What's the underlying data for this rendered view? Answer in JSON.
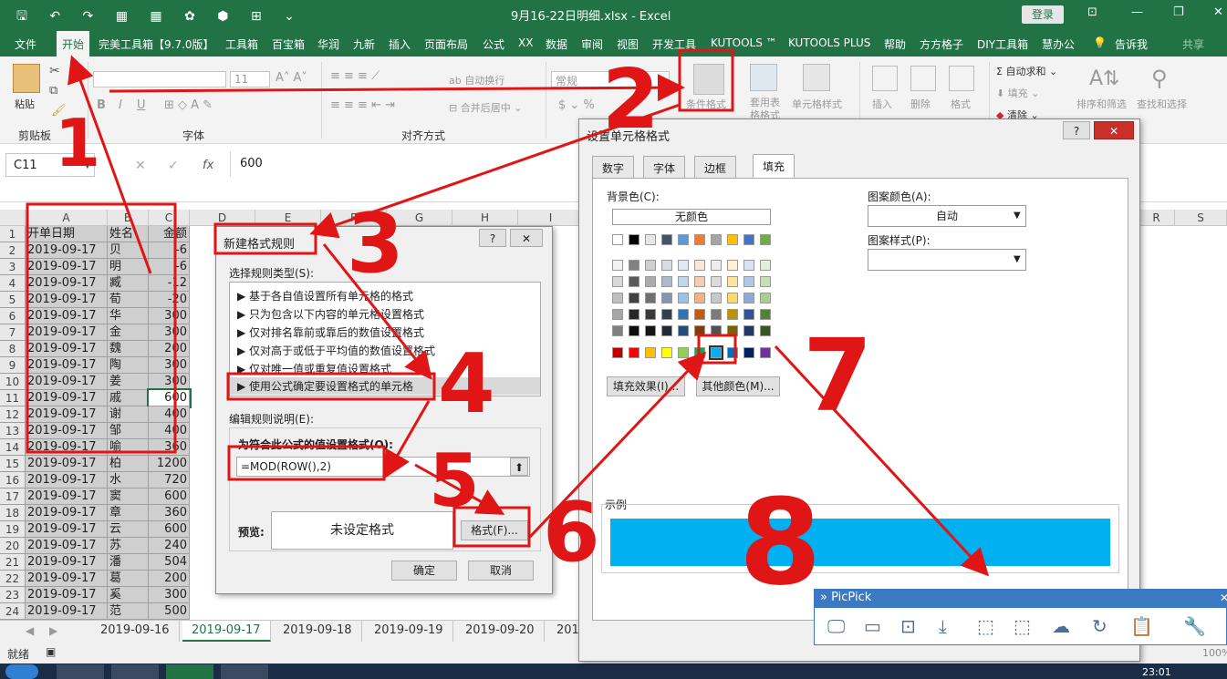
{
  "title_bar": {
    "title": "9月16-22日明细.xlsx - Excel",
    "login": "登录"
  },
  "menu": [
    "文件",
    "开始",
    "完美工具箱【9.7.0版】",
    "工具箱",
    "百宝箱",
    "华润",
    "九新",
    "插入",
    "页面布局",
    "公式",
    "XX",
    "数据",
    "审阅",
    "视图",
    "开发工具",
    "KUTOOLS ™",
    "KUTOOLS PLUS",
    "帮助",
    "方方格子",
    "DIY工具箱",
    "慧办公",
    "告诉我",
    "共享"
  ],
  "ribbon": {
    "paste": "粘贴",
    "clipboard": "剪贴板",
    "font_size": "11",
    "font_group": "字体",
    "wrap_text": "自动换行",
    "merge_center": "合并后居中",
    "align_group": "对齐方式",
    "number_format": "常规",
    "conditional_format": "条件格式",
    "table_format": "套用表格格式",
    "cell_style": "单元格样式",
    "insert": "插入",
    "delete": "删除",
    "format": "格式",
    "autosum": "自动求和",
    "fill": "填充",
    "clear": "清除",
    "sort_filter": "排序和筛选",
    "find_select": "查找和选择"
  },
  "formula_bar": {
    "name_box": "C11",
    "fx": "fx",
    "value": "600"
  },
  "columns": [
    "A",
    "B",
    "C",
    "D",
    "E",
    "F",
    "G",
    "H",
    "I"
  ],
  "far_columns": [
    "R",
    "S"
  ],
  "rows": [
    {
      "n": "1",
      "a": "开单日期",
      "b": "姓名",
      "c": "金额"
    },
    {
      "n": "2",
      "a": "2019-09-17",
      "b": "贝",
      "c": "-6"
    },
    {
      "n": "3",
      "a": "2019-09-17",
      "b": "明",
      "c": "-6"
    },
    {
      "n": "4",
      "a": "2019-09-17",
      "b": "臧",
      "c": "-12"
    },
    {
      "n": "5",
      "a": "2019-09-17",
      "b": "荀",
      "c": "-20"
    },
    {
      "n": "6",
      "a": "2019-09-17",
      "b": "华",
      "c": "300"
    },
    {
      "n": "7",
      "a": "2019-09-17",
      "b": "金",
      "c": "300"
    },
    {
      "n": "8",
      "a": "2019-09-17",
      "b": "魏",
      "c": "200"
    },
    {
      "n": "9",
      "a": "2019-09-17",
      "b": "陶",
      "c": "300"
    },
    {
      "n": "10",
      "a": "2019-09-17",
      "b": "姜",
      "c": "300"
    },
    {
      "n": "11",
      "a": "2019-09-17",
      "b": "戚",
      "c": "600"
    },
    {
      "n": "12",
      "a": "2019-09-17",
      "b": "谢",
      "c": "400"
    },
    {
      "n": "13",
      "a": "2019-09-17",
      "b": "邹",
      "c": "400"
    },
    {
      "n": "14",
      "a": "2019-09-17",
      "b": "喻",
      "c": "360"
    },
    {
      "n": "15",
      "a": "2019-09-17",
      "b": "柏",
      "c": "1200"
    },
    {
      "n": "16",
      "a": "2019-09-17",
      "b": "水",
      "c": "720"
    },
    {
      "n": "17",
      "a": "2019-09-17",
      "b": "窦",
      "c": "600"
    },
    {
      "n": "18",
      "a": "2019-09-17",
      "b": "章",
      "c": "360"
    },
    {
      "n": "19",
      "a": "2019-09-17",
      "b": "云",
      "c": "600"
    },
    {
      "n": "20",
      "a": "2019-09-17",
      "b": "苏",
      "c": "240"
    },
    {
      "n": "21",
      "a": "2019-09-17",
      "b": "潘",
      "c": "504"
    },
    {
      "n": "22",
      "a": "2019-09-17",
      "b": "葛",
      "c": "200"
    },
    {
      "n": "23",
      "a": "2019-09-17",
      "b": "奚",
      "c": "300"
    },
    {
      "n": "24",
      "a": "2019-09-17",
      "b": "范",
      "c": "500"
    }
  ],
  "sheet_tabs": [
    "2019-09-16",
    "2019-09-17",
    "2019-09-18",
    "2019-09-19",
    "2019-09-20",
    "201"
  ],
  "status": {
    "ready": "就绪",
    "zoom": "100%",
    "clock": "23:01"
  },
  "new_rule_dialog": {
    "title": "新建格式规则",
    "select_type": "选择规则类型(S):",
    "rules": [
      "基于各自值设置所有单元格的格式",
      "只为包含以下内容的单元格设置格式",
      "仅对排名靠前或靠后的数值设置格式",
      "仅对高于或低于平均值的数值设置格式",
      "仅对唯一值或重复值设置格式",
      "使用公式确定要设置格式的单元格"
    ],
    "edit_desc": "编辑规则说明(E):",
    "formula_label": "为符合此公式的值设置格式(O):",
    "formula": "=MOD(ROW(),2)",
    "preview_label": "预览:",
    "preview_text": "未设定格式",
    "format_btn": "格式(F)...",
    "ok": "确定",
    "cancel": "取消"
  },
  "format_cells_dialog": {
    "title": "设置单元格格式",
    "tabs": [
      "数字",
      "字体",
      "边框",
      "填充"
    ],
    "bg_color": "背景色(C):",
    "no_color": "无颜色",
    "pattern_color": "图案颜色(A):",
    "pattern_color_value": "自动",
    "pattern_style": "图案样式(P):",
    "fill_effects": "填充效果(I)...",
    "more_colors": "其他颜色(M)...",
    "sample": "示例",
    "sample_color": "#00b0f0",
    "theme_top": [
      "#ffffff",
      "#000000",
      "#e7e6e6",
      "#44546a",
      "#5b9bd5",
      "#ed7d31",
      "#a5a5a5",
      "#ffc000",
      "#4472c4",
      "#70ad47"
    ],
    "theme_shades": [
      [
        "#f2f2f2",
        "#808080",
        "#d0cece",
        "#d6dce4",
        "#deebf6",
        "#fbe5d5",
        "#ededed",
        "#fff2cc",
        "#d9e2f3",
        "#e2efd9"
      ],
      [
        "#d9d9d9",
        "#595959",
        "#aeabab",
        "#adb9ca",
        "#bdd7ee",
        "#f7cbac",
        "#dbdbdb",
        "#fee599",
        "#b4c6e7",
        "#c5e0b3"
      ],
      [
        "#bfbfbf",
        "#404040",
        "#757070",
        "#8496b0",
        "#9cc3e5",
        "#f4b183",
        "#c9c9c9",
        "#ffd965",
        "#8eaadb",
        "#a8d08d"
      ],
      [
        "#a6a6a6",
        "#262626",
        "#3a3838",
        "#323f4f",
        "#2e75b5",
        "#c55a11",
        "#7b7b7b",
        "#bf9000",
        "#2f5496",
        "#538135"
      ],
      [
        "#808080",
        "#0d0d0d",
        "#171616",
        "#222a35",
        "#1e4e79",
        "#833c0b",
        "#525252",
        "#7f6000",
        "#1f3864",
        "#375623"
      ]
    ],
    "standard": [
      "#c00000",
      "#ff0000",
      "#ffc000",
      "#ffff00",
      "#92d050",
      "#00b050",
      "#00b0f0",
      "#0070c0",
      "#002060",
      "#7030a0"
    ]
  },
  "picpick": {
    "title": "» PicPick"
  },
  "annotations": {
    "accent": "#e01515",
    "numbers": [
      "1",
      "2",
      "3",
      "4",
      "5",
      "6",
      "7",
      "8"
    ]
  }
}
